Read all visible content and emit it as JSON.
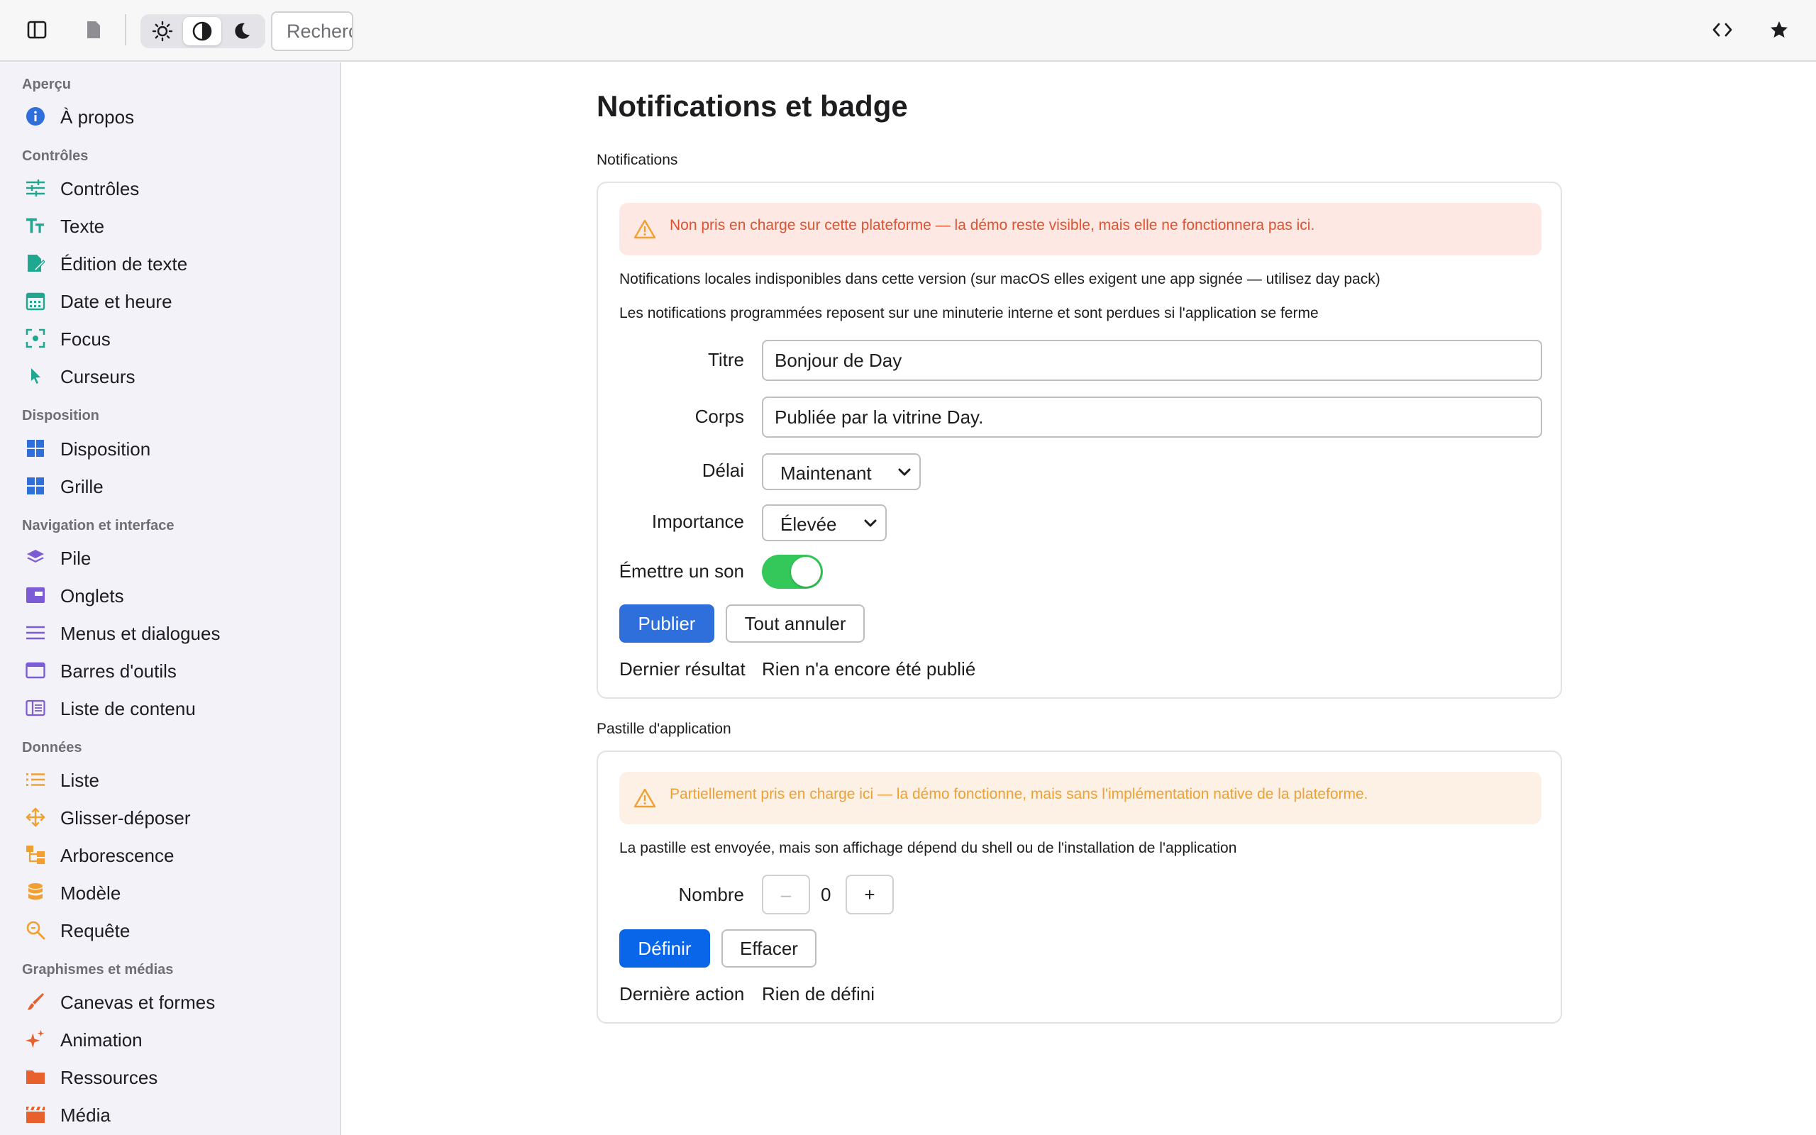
{
  "toolbar": {
    "search_placeholder": "Recherche",
    "icons": [
      "sidebar-toggle-icon",
      "document-icon",
      "sun-icon",
      "contrast-icon",
      "moon-icon",
      "code-icon",
      "star-icon"
    ]
  },
  "sidebar": {
    "sections": [
      {
        "title": "Aperçu",
        "items": [
          {
            "label": "À propos",
            "icon": "info-icon"
          }
        ]
      },
      {
        "title": "Contrôles",
        "items": [
          {
            "label": "Contrôles",
            "icon": "sliders-icon"
          },
          {
            "label": "Texte",
            "icon": "text-icon"
          },
          {
            "label": "Édition de texte",
            "icon": "edit-document-icon"
          },
          {
            "label": "Date et heure",
            "icon": "calendar-icon"
          },
          {
            "label": "Focus",
            "icon": "focus-icon"
          },
          {
            "label": "Curseurs",
            "icon": "cursor-icon"
          }
        ]
      },
      {
        "title": "Disposition",
        "items": [
          {
            "label": "Disposition",
            "icon": "layout-grid-icon"
          },
          {
            "label": "Grille",
            "icon": "grid-icon"
          }
        ]
      },
      {
        "title": "Navigation et interface",
        "items": [
          {
            "label": "Pile",
            "icon": "stack-icon"
          },
          {
            "label": "Onglets",
            "icon": "tabs-icon"
          },
          {
            "label": "Menus et dialogues",
            "icon": "menu-lines-icon"
          },
          {
            "label": "Barres d'outils",
            "icon": "window-icon"
          },
          {
            "label": "Liste de contenu",
            "icon": "columns-icon"
          }
        ]
      },
      {
        "title": "Données",
        "items": [
          {
            "label": "Liste",
            "icon": "list-icon"
          },
          {
            "label": "Glisser-déposer",
            "icon": "move-icon"
          },
          {
            "label": "Arborescence",
            "icon": "tree-icon"
          },
          {
            "label": "Modèle",
            "icon": "database-icon"
          },
          {
            "label": "Requête",
            "icon": "search-icon"
          }
        ]
      },
      {
        "title": "Graphismes et médias",
        "items": [
          {
            "label": "Canevas et formes",
            "icon": "brush-icon"
          },
          {
            "label": "Animation",
            "icon": "sparkle-icon"
          },
          {
            "label": "Ressources",
            "icon": "folder-icon"
          },
          {
            "label": "Média",
            "icon": "clapperboard-icon"
          }
        ]
      }
    ]
  },
  "main": {
    "title": "Notifications et badge",
    "notifications": {
      "group_title": "Notifications",
      "warning": "Non pris en charge sur cette plateforme — la démo reste visible, mais elle ne fonctionnera pas ici.",
      "desc1": "Notifications locales indisponibles dans cette version (sur macOS elles exigent une app signée — utilisez day pack)",
      "desc2": "Les notifications programmées reposent sur une minuterie interne et sont perdues si l'application se ferme",
      "title_label": "Titre",
      "title_value": "Bonjour de Day",
      "body_label": "Corps",
      "body_value": "Publiée par la vitrine Day.",
      "delay_label": "Délai",
      "delay_value": "Maintenant",
      "importance_label": "Importance",
      "importance_value": "Élevée",
      "sound_label": "Émettre un son",
      "sound_on": true,
      "publish_button": "Publier",
      "cancel_all_button": "Tout annuler",
      "last_result_label": "Dernier résultat",
      "last_result_value": "Rien n'a encore été publié"
    },
    "badge": {
      "group_title": "Pastille d'application",
      "warning": "Partiellement pris en charge ici — la démo fonctionne, mais sans l'implémentation native de la plateforme.",
      "desc": "La pastille est envoyée, mais son affichage dépend du shell ou de l'installation de l'application",
      "count_label": "Nombre",
      "decrement": "–",
      "count_value": "0",
      "increment": "+",
      "set_button": "Définir",
      "clear_button": "Effacer",
      "last_action_label": "Dernière action",
      "last_action_value": "Rien de défini"
    }
  },
  "colors": {
    "accent": "#2e6fdb",
    "toggle_on": "#34c759",
    "error_bg": "#fde8e4",
    "error_text": "#e0522e",
    "warning_bg": "#fdf1e6",
    "warning_text": "#f0a030"
  }
}
